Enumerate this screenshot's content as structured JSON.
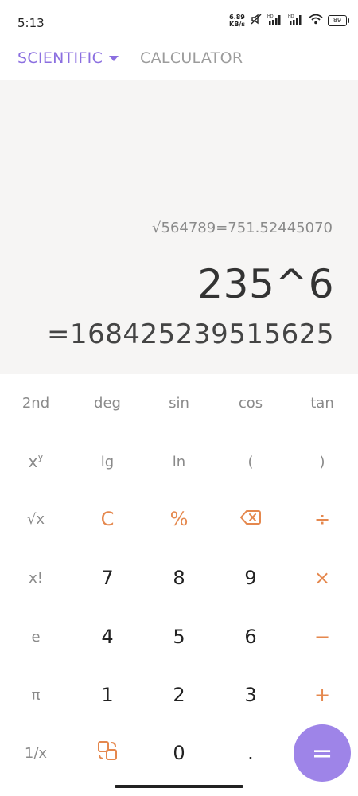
{
  "status": {
    "time": "5:13",
    "net_speed_value": "6.89",
    "net_speed_unit": "KB/s",
    "battery": "89"
  },
  "topbar": {
    "mode_label": "SCIENTIFIC",
    "calculator_label": "CALCULATOR"
  },
  "display": {
    "history": "√564789=751.52445070",
    "expression": "235^6",
    "result": "=168425239515625"
  },
  "keypad": {
    "row1": [
      "2nd",
      "deg",
      "sin",
      "cos",
      "tan"
    ],
    "row2": [
      "x",
      "y",
      "lg",
      "ln",
      "(",
      ")"
    ],
    "row3": [
      "√x",
      "C",
      "%",
      "backspace",
      "÷"
    ],
    "row4": [
      "x!",
      "7",
      "8",
      "9",
      "×"
    ],
    "row5": [
      "e",
      "4",
      "5",
      "6",
      "−"
    ],
    "row6": [
      "π",
      "1",
      "2",
      "3",
      "+"
    ],
    "row7": [
      "1/x",
      "swap",
      "0",
      ".",
      "="
    ]
  },
  "colors": {
    "accent": "#8b6fe0",
    "operator": "#e5884e",
    "equals_bg": "#9e84e8",
    "display_bg": "#f6f5f4"
  }
}
